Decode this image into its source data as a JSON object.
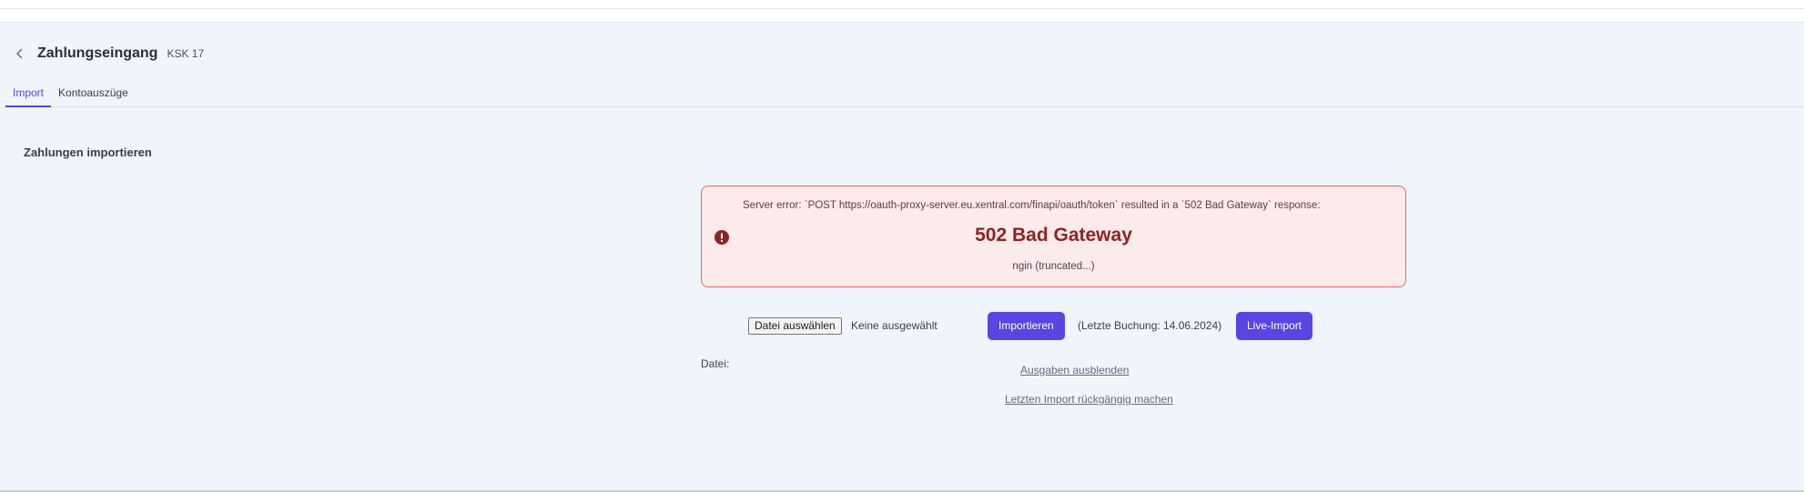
{
  "header": {
    "title": "Zahlungseingang",
    "subtitle": "KSK 17"
  },
  "tabs": [
    {
      "label": "Import",
      "active": true
    },
    {
      "label": "Kontoauszüge",
      "active": false
    }
  ],
  "section": {
    "title": "Zahlungen importieren"
  },
  "error": {
    "message": "Server error: `POST https://oauth-proxy-server.eu.xentral.com/finapi/oauth/token` resulted in a `502 Bad Gateway` response:",
    "headline": "502 Bad Gateway",
    "detail": "ngin (truncated...)",
    "icon": "error-circle-icon",
    "color": "#8b2525"
  },
  "file": {
    "button_label": "Datei auswählen",
    "status": "Keine ausgewählt",
    "label": "Datei:"
  },
  "actions": {
    "import_label": "Importieren",
    "last_booking": "(Letzte Buchung: 14.06.2024)",
    "live_import_label": "Live-Import",
    "hide_expenses_label": "Ausgaben ausblenden",
    "undo_import_label": "Letzten Import rückgängig machen"
  },
  "colors": {
    "accent": "#5a45e0",
    "background": "#f0f4fb",
    "error_bg": "#fdeaea",
    "error_border": "#d86a6a"
  }
}
